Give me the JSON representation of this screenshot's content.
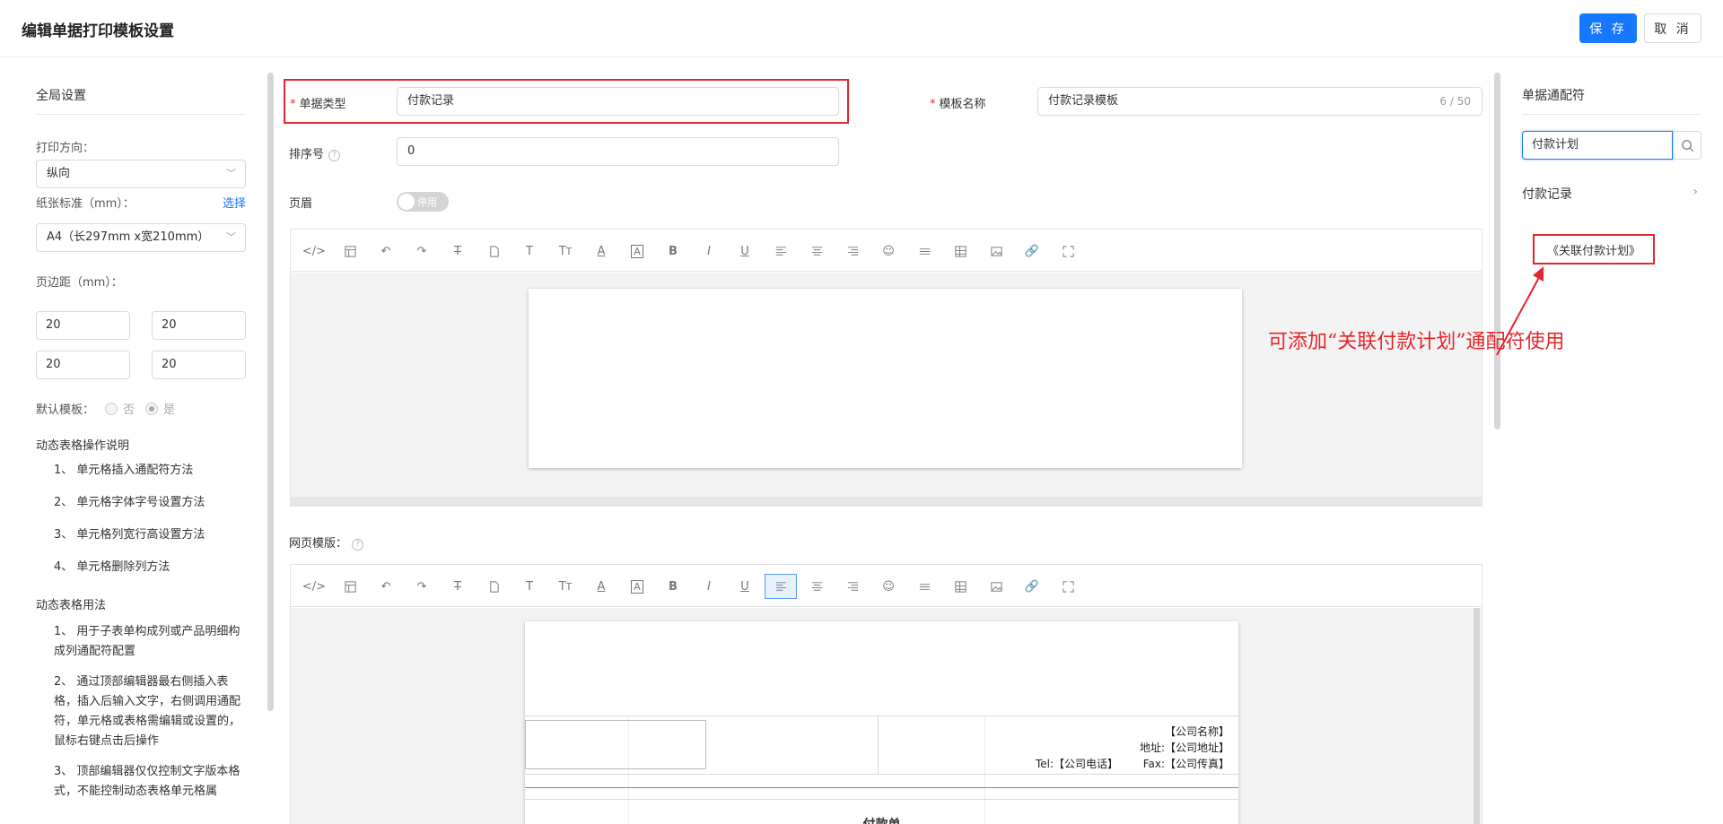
{
  "header": {
    "title": "编辑单据打印模板设置",
    "save_label": "保 存",
    "cancel_label": "取 消"
  },
  "left_panel": {
    "title": "全局设置",
    "print_direction_label": "打印方向：",
    "print_direction_value": "纵向",
    "paper_label": "纸张标准（mm）：",
    "paper_choose": "选择",
    "paper_value": "A4（长297mm x宽210mm）",
    "margin_label": "页边距（mm）：",
    "margins": {
      "top": "20",
      "right": "20",
      "bottom": "20",
      "left": "20"
    },
    "default_label": "默认模板：",
    "default_no": "否",
    "default_yes": "是",
    "dynamic_ops_title": "动态表格操作说明",
    "dynamic_ops": [
      "1、 单元格插入通配符方法",
      "2、 单元格字体字号设置方法",
      "3、 单元格列宽行高设置方法",
      "4、 单元格删除列方法"
    ],
    "dynamic_usage_title": "动态表格用法",
    "dynamic_usage": [
      "1、 用于子表单构成列或产品明细构成列通配符配置",
      "2、 通过顶部编辑器最右侧插入表格，插入后输入文字，右侧调用通配符，单元格或表格需编辑或设置的，鼠标右键点击后操作",
      "3、 顶部编辑器仅仅控制文字版本格式，不能控制动态表格单元格属"
    ]
  },
  "form": {
    "doc_type_label": "单据类型",
    "doc_type_value": "付款记录",
    "template_name_label": "模板名称",
    "template_name_value": "付款记录模板",
    "template_name_counter": "6 / 50",
    "sort_label": "排序号",
    "sort_value": "0",
    "header_label": "页眉",
    "header_switch": "停用",
    "web_template_label": "网页模版："
  },
  "template": {
    "company_name": "【公司名称】",
    "company_address": "地址:【公司地址】",
    "company_tel": "Tel:【公司电话】",
    "company_fax": "Fax:【公司传真】",
    "doc_title": "付款单"
  },
  "right_panel": {
    "title": "单据通配符",
    "search_value": "付款计划",
    "tree_item": "付款记录",
    "tag": "《关联付款计划》"
  },
  "annotation": "可添加“关联付款计划”通配符使用",
  "colors": {
    "primary": "#1677ff",
    "annotation_red": "#e4252b"
  }
}
